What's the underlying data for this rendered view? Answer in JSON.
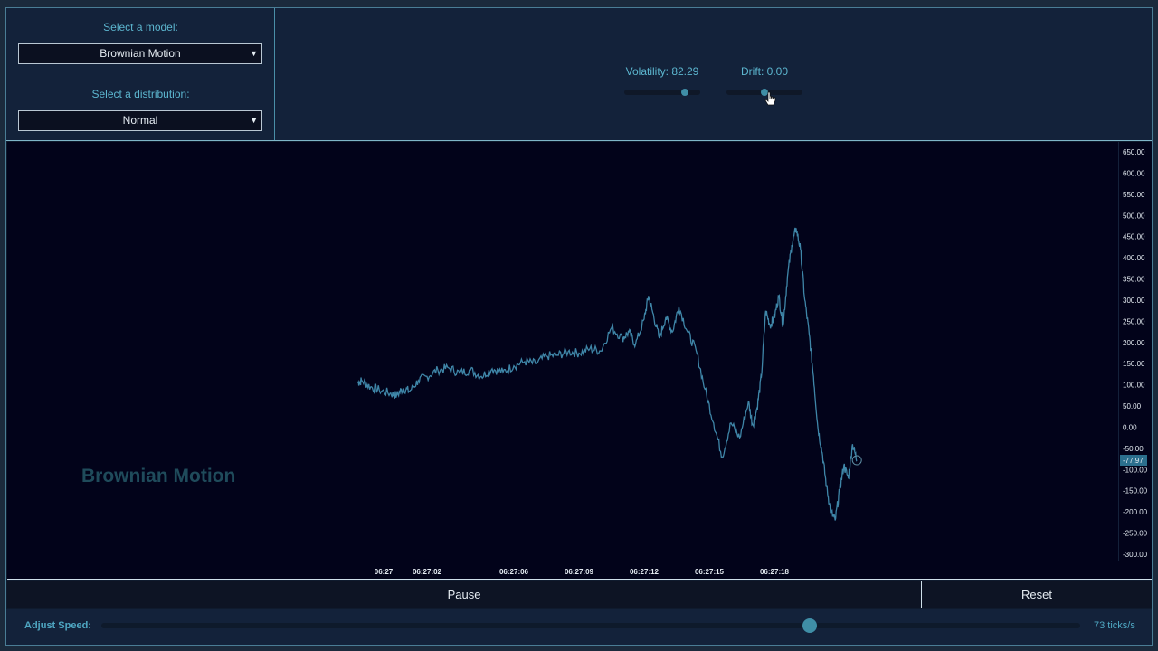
{
  "controls": {
    "model_label": "Select a model:",
    "model_value": "Brownian Motion",
    "distribution_label": "Select a distribution:",
    "distribution_value": "Normal",
    "volatility_label": "Volatility: 82.29",
    "drift_label": "Drift: 0.00"
  },
  "chart": {
    "watermark": "Brownian Motion",
    "current_value_label": "-77.97"
  },
  "chart_data": {
    "type": "line",
    "series_color": "#3f86a8",
    "ylim": [
      -300,
      650
    ],
    "y_ticks": [
      "650.00",
      "600.00",
      "550.00",
      "500.00",
      "450.00",
      "400.00",
      "350.00",
      "300.00",
      "250.00",
      "200.00",
      "150.00",
      "100.00",
      "50.00",
      "0.00",
      "-50.00",
      "-100.00",
      "-150.00",
      "-200.00",
      "-250.00",
      "-300.00"
    ],
    "x_ticks": [
      "06:27",
      "06:27:02",
      "06:27:06",
      "06:27:09",
      "06:27:12",
      "06:27:15",
      "06:27:18"
    ],
    "x_tick_seconds": [
      0,
      2,
      6,
      9,
      12,
      15,
      18
    ],
    "points": [
      [
        -1.2,
        105
      ],
      [
        -1.0,
        110
      ],
      [
        -0.6,
        95
      ],
      [
        -0.2,
        88
      ],
      [
        0.3,
        80
      ],
      [
        0.6,
        75
      ],
      [
        0.9,
        92
      ],
      [
        1.2,
        85
      ],
      [
        1.6,
        110
      ],
      [
        2.0,
        120
      ],
      [
        2.5,
        135
      ],
      [
        3.0,
        140
      ],
      [
        3.5,
        128
      ],
      [
        4.0,
        135
      ],
      [
        4.5,
        120
      ],
      [
        5.0,
        138
      ],
      [
        5.5,
        130
      ],
      [
        6.0,
        145
      ],
      [
        6.5,
        155
      ],
      [
        7.0,
        150
      ],
      [
        7.5,
        168
      ],
      [
        8.0,
        170
      ],
      [
        8.5,
        178
      ],
      [
        9.0,
        175
      ],
      [
        9.5,
        185
      ],
      [
        10.0,
        180
      ],
      [
        10.5,
        235
      ],
      [
        11.0,
        210
      ],
      [
        11.3,
        225
      ],
      [
        11.6,
        195
      ],
      [
        12.0,
        255
      ],
      [
        12.2,
        310
      ],
      [
        12.4,
        270
      ],
      [
        12.7,
        210
      ],
      [
        13.0,
        260
      ],
      [
        13.3,
        225
      ],
      [
        13.6,
        285
      ],
      [
        14.0,
        225
      ],
      [
        14.4,
        180
      ],
      [
        14.8,
        90
      ],
      [
        15.2,
        10
      ],
      [
        15.6,
        -70
      ],
      [
        16.0,
        10
      ],
      [
        16.4,
        -25
      ],
      [
        16.8,
        60
      ],
      [
        17.0,
        5
      ],
      [
        17.2,
        45
      ],
      [
        17.4,
        120
      ],
      [
        17.6,
        275
      ],
      [
        17.8,
        240
      ],
      [
        18.0,
        260
      ],
      [
        18.2,
        310
      ],
      [
        18.4,
        240
      ],
      [
        18.6,
        355
      ],
      [
        18.8,
        430
      ],
      [
        19.0,
        470
      ],
      [
        19.2,
        420
      ],
      [
        19.4,
        300
      ],
      [
        19.6,
        220
      ],
      [
        19.8,
        120
      ],
      [
        20.0,
        0
      ],
      [
        20.2,
        -60
      ],
      [
        20.4,
        -140
      ],
      [
        20.6,
        -200
      ],
      [
        20.8,
        -220
      ],
      [
        21.0,
        -150
      ],
      [
        21.2,
        -90
      ],
      [
        21.4,
        -120
      ],
      [
        21.6,
        -40
      ],
      [
        21.8,
        -78
      ]
    ]
  },
  "actions": {
    "pause_label": "Pause",
    "reset_label": "Reset"
  },
  "speed": {
    "label": "Adjust Speed:",
    "value_label": "73 ticks/s",
    "slider_fraction": 0.72
  }
}
